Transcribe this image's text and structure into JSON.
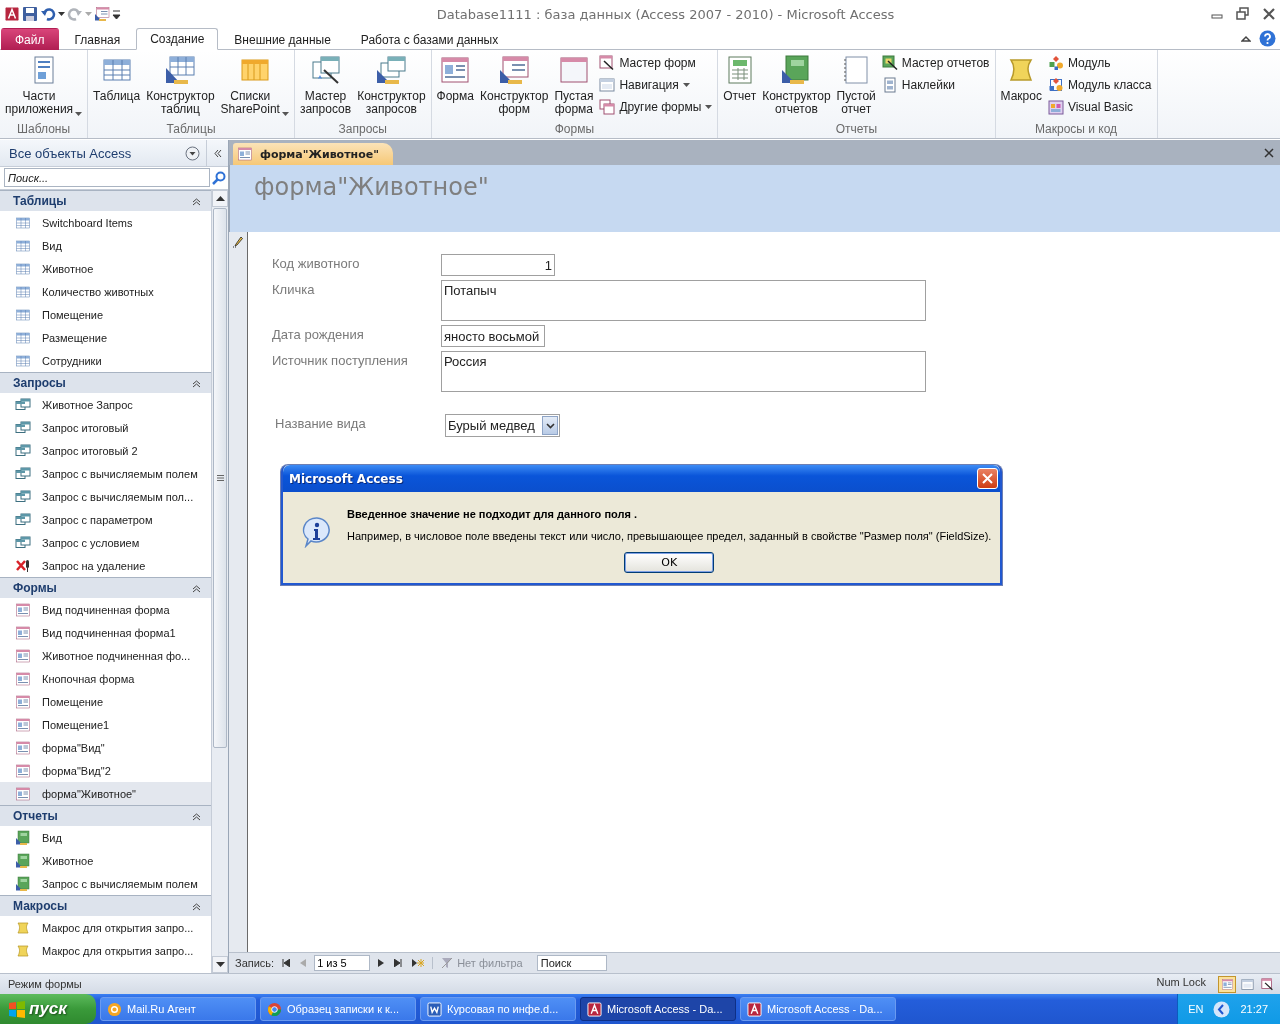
{
  "window": {
    "title": "Database1111 : база данных (Access 2007 - 2010)  -  Microsoft Access"
  },
  "tabs": [
    {
      "label": "Файл",
      "kind": "file",
      "selected": false
    },
    {
      "label": "Главная",
      "kind": "normal",
      "selected": false
    },
    {
      "label": "Создание",
      "kind": "normal",
      "selected": true
    },
    {
      "label": "Внешние данные",
      "kind": "normal",
      "selected": false
    },
    {
      "label": "Работа с базами данных",
      "kind": "normal",
      "selected": false
    }
  ],
  "ribbon_groups": [
    {
      "label": "Шаблоны",
      "items": [
        {
          "label": "Части приложения",
          "large": true,
          "kind": "parts",
          "dropdown": true
        }
      ]
    },
    {
      "label": "Таблицы",
      "items": [
        {
          "label": "Таблица",
          "large": true,
          "kind": "table",
          "dropdown": false
        },
        {
          "label": "Конструктор таблиц",
          "large": true,
          "kind": "table-design",
          "dropdown": false
        },
        {
          "label": "Списки SharePoint",
          "large": true,
          "kind": "sharepoint",
          "dropdown": true
        }
      ]
    },
    {
      "label": "Запросы",
      "items": [
        {
          "label": "Мастер запросов",
          "large": true,
          "kind": "query-wizard",
          "dropdown": false
        },
        {
          "label": "Конструктор запросов",
          "large": true,
          "kind": "query-design",
          "dropdown": false
        }
      ]
    },
    {
      "label": "Формы",
      "items": [
        {
          "label": "Форма",
          "large": true,
          "kind": "form",
          "dropdown": false
        },
        {
          "label": "Конструктор форм",
          "large": true,
          "kind": "form-design",
          "dropdown": false
        },
        {
          "label": "Пустая форма",
          "large": true,
          "kind": "blank-form",
          "dropdown": false
        },
        {
          "label": "Мастер форм",
          "large": false,
          "kind": "form-wizard",
          "dropdown": false
        },
        {
          "label": "Навигация",
          "large": false,
          "kind": "navigation",
          "dropdown": true
        },
        {
          "label": "Другие формы",
          "large": false,
          "kind": "more-forms",
          "dropdown": true
        }
      ]
    },
    {
      "label": "Отчеты",
      "items": [
        {
          "label": "Отчет",
          "large": true,
          "kind": "report",
          "dropdown": false
        },
        {
          "label": "Конструктор отчетов",
          "large": true,
          "kind": "report-design",
          "dropdown": false
        },
        {
          "label": "Пустой отчет",
          "large": true,
          "kind": "blank-report",
          "dropdown": false
        },
        {
          "label": "Мастер отчетов",
          "large": false,
          "kind": "report-wizard",
          "dropdown": false
        },
        {
          "label": "Наклейки",
          "large": false,
          "kind": "labels",
          "dropdown": false
        }
      ]
    },
    {
      "label": "Макросы и код",
      "items": [
        {
          "label": "Макрос",
          "large": true,
          "kind": "macro",
          "dropdown": false
        },
        {
          "label": "Модуль",
          "large": false,
          "kind": "module",
          "dropdown": false
        },
        {
          "label": "Модуль класса",
          "large": false,
          "kind": "class-module",
          "dropdown": false
        },
        {
          "label": "Visual Basic",
          "large": false,
          "kind": "vba",
          "dropdown": false
        }
      ]
    }
  ],
  "nav": {
    "title": "Все объекты Access",
    "search_placeholder": "Поиск...",
    "groups": [
      {
        "label": "Таблицы",
        "items": [
          {
            "label": "Switchboard Items",
            "kind": "table",
            "selected": false
          },
          {
            "label": "Вид",
            "kind": "table",
            "selected": false
          },
          {
            "label": "Животное",
            "kind": "table",
            "selected": false
          },
          {
            "label": "Количество животных",
            "kind": "table",
            "selected": false
          },
          {
            "label": "Помещение",
            "kind": "table",
            "selected": false
          },
          {
            "label": "Размещение",
            "kind": "table",
            "selected": false
          },
          {
            "label": "Сотрудники",
            "kind": "table",
            "selected": false
          }
        ]
      },
      {
        "label": "Запросы",
        "items": [
          {
            "label": "Животное Запрос",
            "kind": "query",
            "selected": false
          },
          {
            "label": "Запрос итоговый",
            "kind": "query",
            "selected": false
          },
          {
            "label": "Запрос итоговый 2",
            "kind": "query",
            "selected": false
          },
          {
            "label": "Запрос с вычисляемым полем",
            "kind": "query",
            "selected": false
          },
          {
            "label": "Запрос с вычисляемым пол...",
            "kind": "query",
            "selected": false
          },
          {
            "label": "Запрос с параметром",
            "kind": "query",
            "selected": false
          },
          {
            "label": "Запрос с условием",
            "kind": "query",
            "selected": false
          },
          {
            "label": "Запрос на удаление",
            "kind": "delete-query",
            "selected": false
          }
        ]
      },
      {
        "label": "Формы",
        "items": [
          {
            "label": "Вид подчиненная форма",
            "kind": "form",
            "selected": false
          },
          {
            "label": "Вид подчиненная форма1",
            "kind": "form",
            "selected": false
          },
          {
            "label": "Животное подчиненная фо...",
            "kind": "form",
            "selected": false
          },
          {
            "label": "Кнопочная форма",
            "kind": "form",
            "selected": false
          },
          {
            "label": "Помещение",
            "kind": "form",
            "selected": false
          },
          {
            "label": "Помещение1",
            "kind": "form",
            "selected": false
          },
          {
            "label": "форма\"Вид\"",
            "kind": "form",
            "selected": false
          },
          {
            "label": "форма\"Вид\"2",
            "kind": "form",
            "selected": false
          },
          {
            "label": "форма\"Животное\"",
            "kind": "form",
            "selected": true
          }
        ]
      },
      {
        "label": "Отчеты",
        "items": [
          {
            "label": "Вид",
            "kind": "report",
            "selected": false
          },
          {
            "label": "Животное",
            "kind": "report",
            "selected": false
          },
          {
            "label": "Запрос с вычисляемым полем",
            "kind": "report",
            "selected": false
          }
        ]
      },
      {
        "label": "Макросы",
        "items": [
          {
            "label": "Макрос для открытия запро...",
            "kind": "macro",
            "selected": false
          },
          {
            "label": "Макрос для открытия запро...",
            "kind": "macro",
            "selected": false
          }
        ]
      }
    ]
  },
  "document_tab": {
    "label": "форма\"Животное\""
  },
  "form": {
    "title": "форма\"Животное\"",
    "fields": [
      {
        "label": "Код животного",
        "value": "1",
        "kind": "number"
      },
      {
        "label": "Кличка",
        "value": "Потапыч",
        "kind": "memo"
      },
      {
        "label": "Дата рождения",
        "value": "яносто восьмой",
        "kind": "text"
      },
      {
        "label": "Источник поступления",
        "value": "Россия",
        "kind": "memo"
      },
      {
        "label": "Название вида",
        "value": "Бурый медвед",
        "kind": "combo"
      }
    ]
  },
  "dialog": {
    "title": "Microsoft Access",
    "heading": "Введенное значение не подходит для данного поля .",
    "message": "Например, в числовое поле введены текст или число, превышающее предел, заданный в свойстве \"Размер поля\" (FieldSize).",
    "button": "OK"
  },
  "record_nav": {
    "label": "Запись:",
    "position": "1 из 5",
    "filter": "Нет фильтра",
    "search_placeholder": "Поиск"
  },
  "status_bar": {
    "mode": "Режим формы",
    "num_lock": "Num Lock"
  },
  "taskbar": {
    "start": "пуск",
    "tasks": [
      {
        "label": "Mail.Ru Агент",
        "kind": "mail",
        "selected": false
      },
      {
        "label": "Образец записки к к...",
        "kind": "browser",
        "selected": false
      },
      {
        "label": "Курсовая по инфе.d...",
        "kind": "word",
        "selected": false
      },
      {
        "label": "Microsoft Access - Da...",
        "kind": "access",
        "selected": true
      },
      {
        "label": "Microsoft Access - Da...",
        "kind": "access",
        "selected": false
      }
    ],
    "language": "EN",
    "clock": "21:27"
  }
}
